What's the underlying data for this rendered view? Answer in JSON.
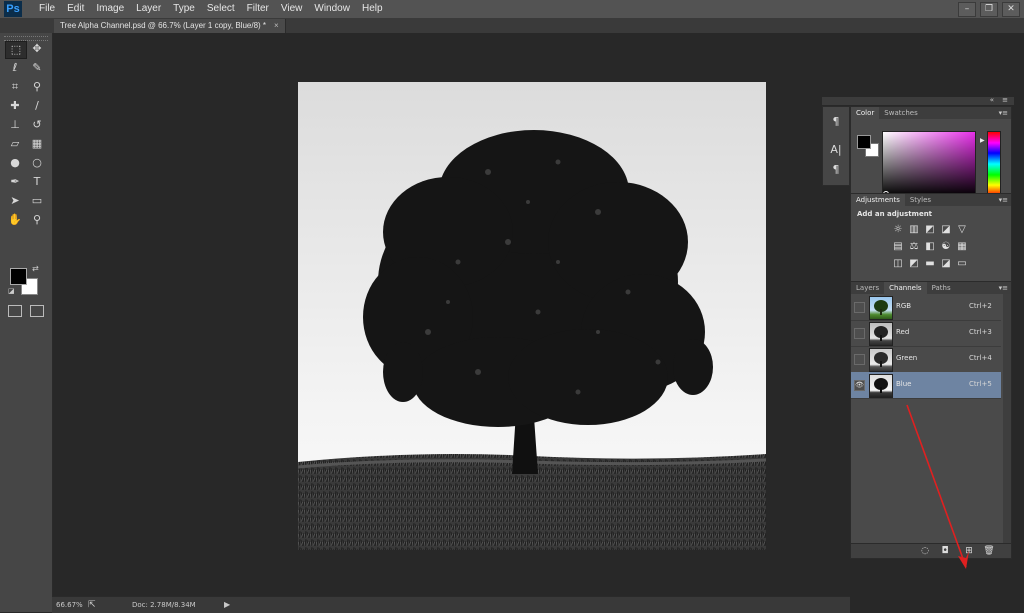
{
  "app": {
    "logo": "Ps"
  },
  "menu": [
    "File",
    "Edit",
    "Image",
    "Layer",
    "Type",
    "Select",
    "Filter",
    "View",
    "Window",
    "Help"
  ],
  "window_controls": {
    "minimize": "–",
    "restore": "❐",
    "close": "✕"
  },
  "document_tab": {
    "title": "Tree Alpha Channel.psd @ 66.7% (Layer 1 copy, Blue/8) *",
    "close": "×"
  },
  "tool_icons": [
    "marquee-icon",
    "move-icon",
    "lasso-icon",
    "quick-select-icon",
    "crop-icon",
    "eyedropper-icon",
    "healing-brush-icon",
    "brush-icon",
    "clone-stamp-icon",
    "history-brush-icon",
    "eraser-icon",
    "gradient-icon",
    "blur-icon",
    "dodge-icon",
    "pen-icon",
    "type-icon",
    "path-select-icon",
    "rectangle-icon",
    "hand-icon",
    "zoom-icon"
  ],
  "tool_glyphs": [
    "⬚",
    "✥",
    "ℓ",
    "✎",
    "⌗",
    "⚲",
    "✚",
    "/",
    "⊥",
    "↺",
    "▱",
    "▦",
    "●",
    "○",
    "✒",
    "T",
    "➤",
    "▭",
    "✋",
    "⚲"
  ],
  "colors": {
    "foreground": "#000000",
    "background": "#ffffff",
    "accent_selected": "#6e84a2"
  },
  "panels": {
    "color_tabs": [
      "Color",
      "Swatches"
    ],
    "adjustment_tabs": [
      "Adjustments",
      "Styles"
    ],
    "adjustment_title": "Add an adjustment",
    "adjustment_icons": [
      [
        "☼",
        "▥",
        "◩",
        "◪",
        "▽"
      ],
      [
        "▤",
        "⚖",
        "◧",
        "☯",
        "▦"
      ],
      [
        "◫",
        "◩",
        "▬",
        "◪",
        "▭"
      ]
    ],
    "channel_tabs": [
      "Layers",
      "Channels",
      "Paths"
    ],
    "panel_menu": "▾≡",
    "channels": [
      {
        "name": "RGB",
        "shortcut": "Ctrl+2",
        "visible": false,
        "selected": false
      },
      {
        "name": "Red",
        "shortcut": "Ctrl+3",
        "visible": false,
        "selected": false
      },
      {
        "name": "Green",
        "shortcut": "Ctrl+4",
        "visible": false,
        "selected": false
      },
      {
        "name": "Blue",
        "shortcut": "Ctrl+5",
        "visible": true,
        "selected": true
      }
    ],
    "channel_footer_icons": [
      "◌",
      "◘",
      "⊞",
      "🗑"
    ]
  },
  "mini_panel_icons": [
    "¶",
    "A|",
    "¶"
  ],
  "statusbar": {
    "zoom": "66.67%",
    "export": "⇱",
    "doc": "Doc: 2.78M/8.34M",
    "arrow": "▶"
  }
}
